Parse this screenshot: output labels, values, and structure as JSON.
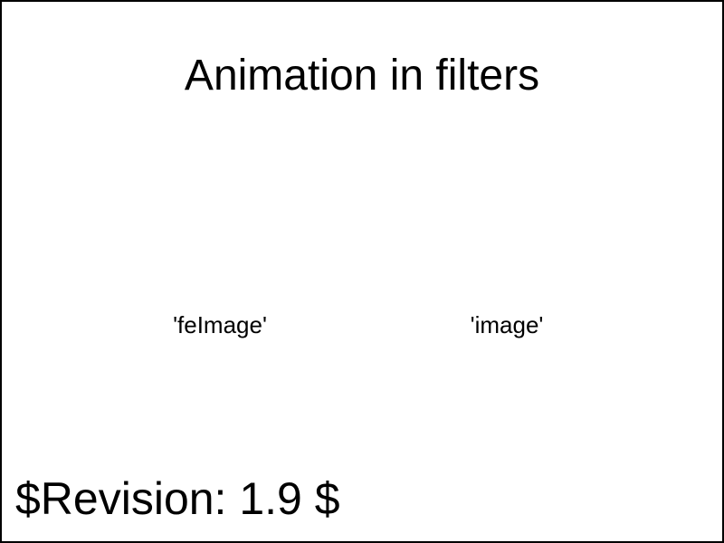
{
  "title": "Animation in filters",
  "captions": {
    "left": "'feImage'",
    "right": "'image'"
  },
  "revision": "$Revision: 1.9 $",
  "colors": {
    "background": "#ffffff",
    "border": "#000000",
    "text": "#000000"
  }
}
